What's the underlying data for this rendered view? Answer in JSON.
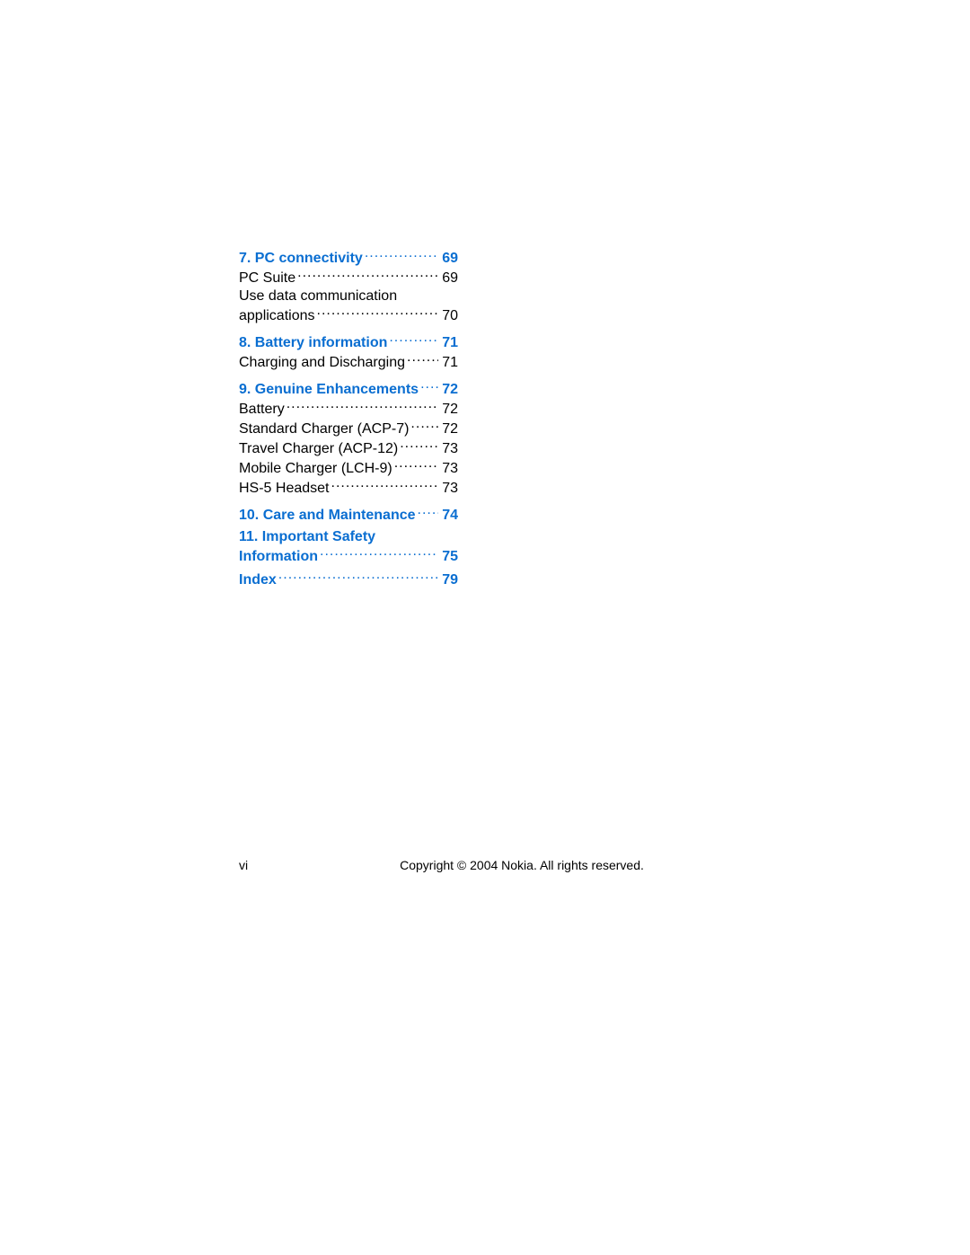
{
  "toc": {
    "ch7": {
      "label": "7. PC connectivity",
      "page": "69"
    },
    "s7a": {
      "label": "PC Suite",
      "page": "69"
    },
    "s7b1": {
      "label": "Use data communication"
    },
    "s7b2": {
      "label": "applications",
      "page": "70"
    },
    "ch8": {
      "label": "8. Battery information",
      "page": "71"
    },
    "s8a": {
      "label": "Charging and Discharging",
      "page": "71"
    },
    "ch9": {
      "label": "9. Genuine Enhancements",
      "page": "72"
    },
    "s9a": {
      "label": "Battery",
      "page": "72"
    },
    "s9b": {
      "label": "Standard Charger (ACP-7)",
      "page": "72"
    },
    "s9c": {
      "label": "Travel Charger (ACP-12)",
      "page": "73"
    },
    "s9d": {
      "label": "Mobile Charger (LCH-9)",
      "page": "73"
    },
    "s9e": {
      "label": "HS-5 Headset",
      "page": "73"
    },
    "ch10": {
      "label": "10. Care and Maintenance",
      "page": "74"
    },
    "ch11a": {
      "label": "11. Important Safety"
    },
    "ch11b": {
      "label": "Information",
      "page": "75"
    },
    "idx": {
      "label": "Index",
      "page": "79"
    }
  },
  "footer": {
    "page_roman": "vi",
    "copyright": "Copyright © 2004 Nokia. All rights reserved."
  }
}
